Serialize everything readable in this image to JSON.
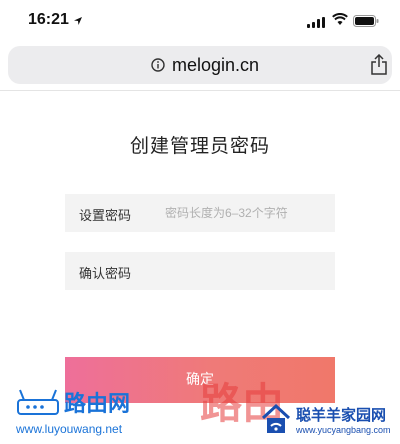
{
  "status_bar": {
    "time": "16:21"
  },
  "browser": {
    "url": "melogin.cn"
  },
  "page": {
    "title": "创建管理员密码",
    "fields": [
      {
        "label": "设置密码",
        "placeholder": "密码长度为6–32个字符",
        "value": ""
      },
      {
        "label": "确认密码",
        "placeholder": "",
        "value": ""
      }
    ],
    "confirm_label": "确定"
  },
  "watermarks": {
    "left_logo_text": "路由网",
    "left_url": "www.luyouwang.net",
    "mid_text": "路由",
    "right_text": "聪羊羊家园网",
    "right_url": "www.yucyangbang.com"
  },
  "colors": {
    "button_gradient_start": "#ee6f9a",
    "button_gradient_end": "#f0786a",
    "field_background": "#f3f3f3",
    "url_bar_background": "#ececee"
  }
}
